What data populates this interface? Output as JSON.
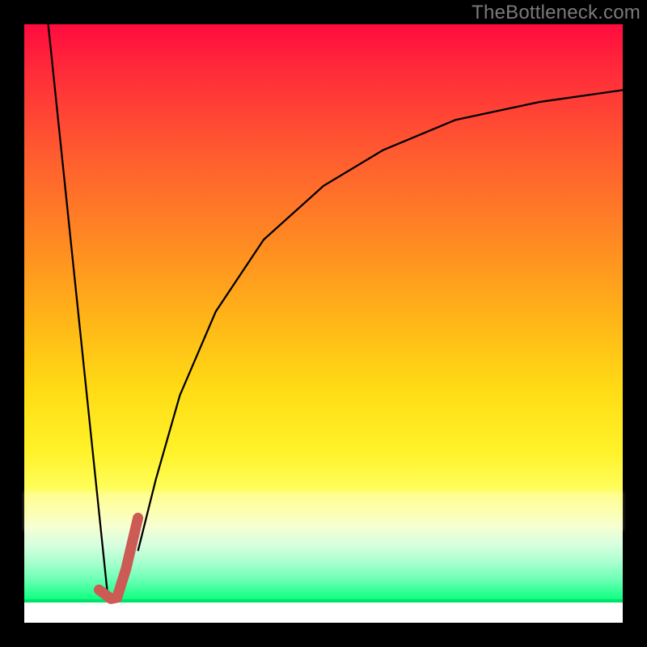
{
  "watermark": "TheBottleneck.com",
  "chart_data": {
    "type": "line",
    "title": "",
    "xlabel": "",
    "ylabel": "",
    "xlim": [
      0,
      100
    ],
    "ylim": [
      0,
      100
    ],
    "grid": false,
    "series": [
      {
        "name": "left-descent",
        "x": [
          4,
          14
        ],
        "values": [
          100,
          4
        ],
        "stroke": "#000000",
        "width": 2.3
      },
      {
        "name": "right-curve",
        "x": [
          19,
          22,
          26,
          32,
          40,
          50,
          60,
          72,
          86,
          100
        ],
        "values": [
          12,
          24,
          38,
          52,
          64,
          73,
          79,
          84,
          87,
          89
        ],
        "stroke": "#000000",
        "width": 2.3
      },
      {
        "name": "marker-hook",
        "x": [
          12.5,
          14.5,
          15.5,
          17.0,
          19.0
        ],
        "values": [
          5.5,
          4.0,
          4.2,
          9.0,
          17.5
        ],
        "stroke": "#cc5a55",
        "width": 13,
        "linecap": "round"
      }
    ]
  },
  "colors": {
    "gradient_top": "#ff0b3e",
    "gradient_bottom": "#00ff7a",
    "marker": "#cc5a55",
    "frame": "#000000",
    "watermark": "#7a7a7a"
  }
}
